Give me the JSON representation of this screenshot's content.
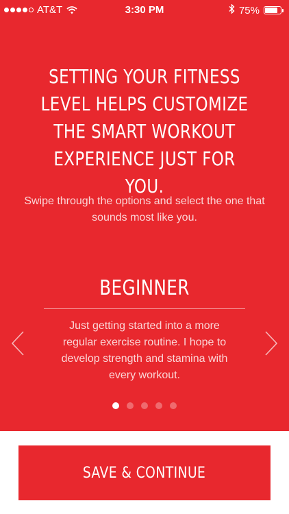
{
  "status_bar": {
    "carrier": "AT&T",
    "time": "3:30 PM",
    "battery_percent": "75%",
    "signal_bars": 4,
    "icons": [
      "wifi-icon",
      "bluetooth-icon",
      "battery-icon"
    ]
  },
  "intro": {
    "headline": "SETTING YOUR FITNESS LEVEL HELPS CUSTOMIZE THE SMART WORKOUT EXPERIENCE JUST FOR YOU.",
    "subtext": "Swipe through the options and select the one that sounds most like you."
  },
  "carousel": {
    "current_index": 0,
    "total": 5,
    "title": "BEGINNER",
    "description": "Just getting started into a more regular exercise routine. I hope to develop strength and stamina with every workout.",
    "prev_icon": "chevron-left-icon",
    "next_icon": "chevron-right-icon"
  },
  "footer": {
    "save_label": "SAVE & CONTINUE"
  },
  "colors": {
    "accent": "#e8282e",
    "background": "#ffffff"
  }
}
